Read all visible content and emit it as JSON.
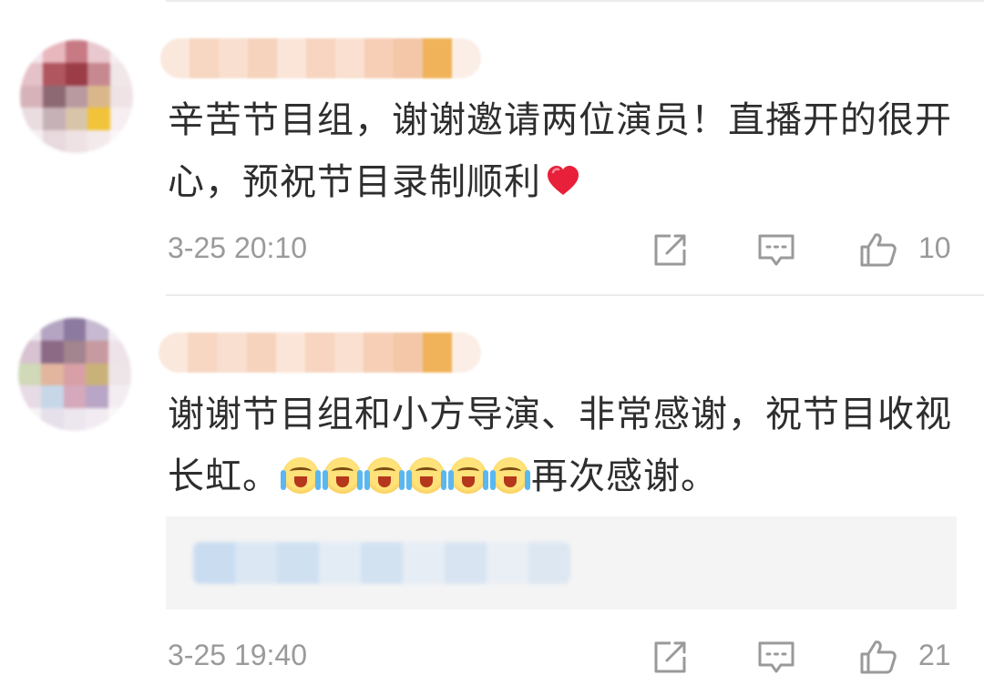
{
  "comments": [
    {
      "text": "辛苦节目组，谢谢邀请两位演员！直播开的很开心，预祝节目录制顺利",
      "emoji": "red-heart",
      "timestamp": "3-25 20:10",
      "likes": "10"
    },
    {
      "text_before": "谢谢节目组和小方导演、非常感谢，祝节目收视长虹。",
      "emoji": "crying-laughing-face",
      "emoji_repeat": 6,
      "text_after": "再次感谢。",
      "timestamp": "3-25 19:40",
      "likes": "21"
    }
  ],
  "icons": [
    "share-icon",
    "comment-icon",
    "like-icon"
  ],
  "colors": {
    "text": "#2e2e2e",
    "meta": "#9a9a9a",
    "divider": "#ececec",
    "reply_bg": "#f4f4f4",
    "heart": "#e8203a"
  }
}
